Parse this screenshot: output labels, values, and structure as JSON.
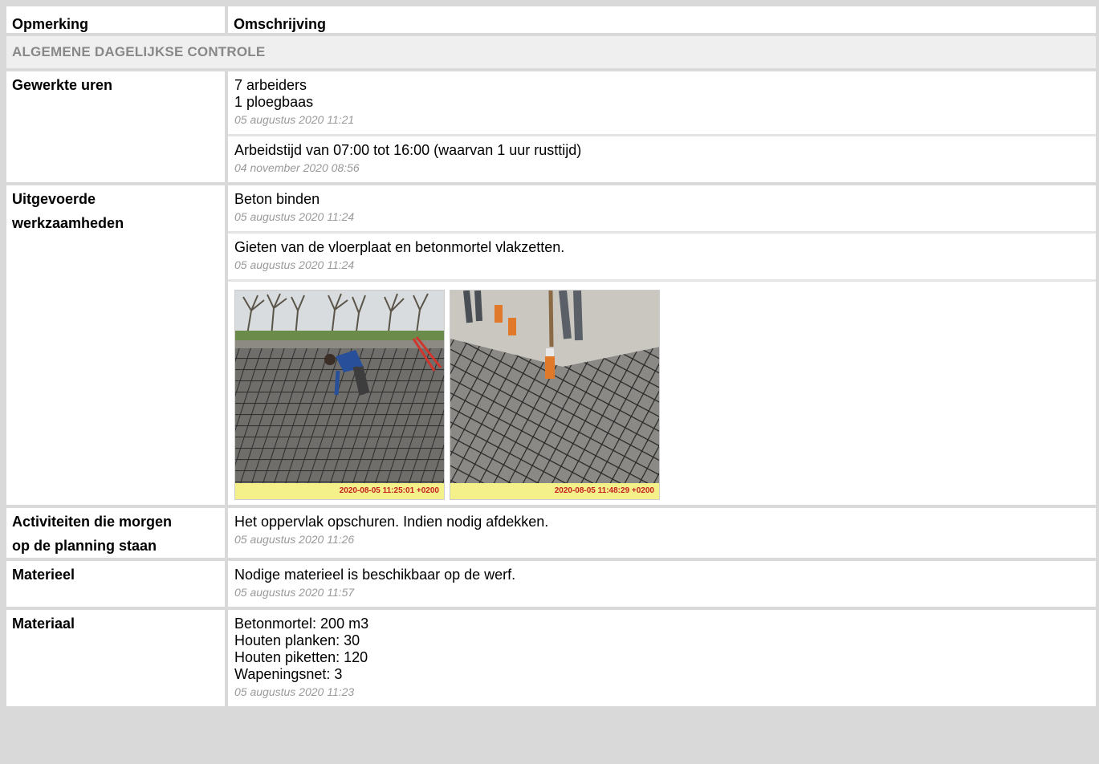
{
  "table": {
    "col_remark": "Opmerking",
    "col_description": "Omschrijving",
    "section_title": "ALGEMENE DAGELIJKSE CONTROLE"
  },
  "rows": {
    "hours": {
      "label": "Gewerkte uren",
      "entries": [
        {
          "lines": [
            "7 arbeiders",
            "1 ploegbaas"
          ],
          "stamp": "05 augustus 2020 11:21"
        },
        {
          "lines": [
            "Arbeidstijd van 07:00 tot 16:00 (waarvan 1 uur rusttijd)"
          ],
          "stamp": "04 november 2020 08:56"
        }
      ]
    },
    "work": {
      "label_line1": "Uitgevoerde",
      "label_line2": "werkzaamheden",
      "entries": [
        {
          "lines": [
            "Beton binden"
          ],
          "stamp": "05 augustus 2020 11:24"
        },
        {
          "lines": [
            "Gieten van de vloerplaat en betonmortel vlakzetten."
          ],
          "stamp": "05 augustus 2020 11:24"
        }
      ],
      "photos": [
        {
          "timestamp": "2020-08-05 11:25:01 +0200"
        },
        {
          "timestamp": "2020-08-05 11:48:29 +0200"
        }
      ]
    },
    "tomorrow": {
      "label_line1": "Activiteiten die morgen",
      "label_line2": "op de planning staan",
      "entries": [
        {
          "lines": [
            "Het oppervlak opschuren. Indien nodig afdekken."
          ],
          "stamp": "05 augustus 2020 11:26"
        }
      ]
    },
    "equipment": {
      "label": "Materieel",
      "entries": [
        {
          "lines": [
            "Nodige materieel is beschikbaar op de werf."
          ],
          "stamp": "05 augustus 2020 11:57"
        }
      ]
    },
    "material": {
      "label": "Materiaal",
      "entries": [
        {
          "lines": [
            "Betonmortel: 200 m3",
            "Houten planken: 30",
            "Houten piketten: 120",
            "Wapeningsnet: 3"
          ],
          "stamp": "05 augustus 2020 11:23"
        }
      ]
    }
  },
  "colors": {
    "frame": "#d9d9d9",
    "section_bg": "#efefef",
    "section_text": "#888888",
    "stamp_text": "#999999",
    "photo_stamp_bg": "#f4f08a",
    "photo_stamp_text": "#c42020"
  }
}
